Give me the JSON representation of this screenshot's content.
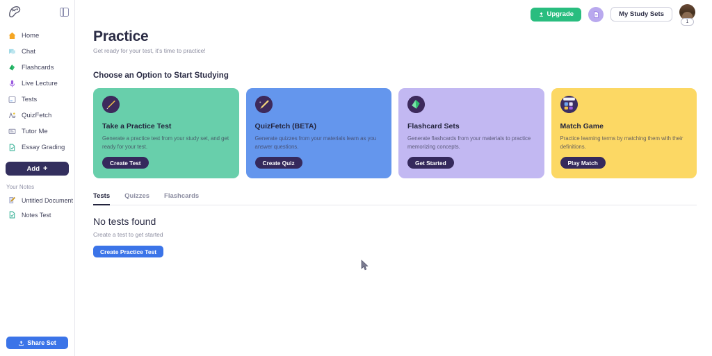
{
  "sidebar": {
    "logo_name": "app-logo",
    "toggle_name": "panel-toggle-icon",
    "nav": [
      {
        "label": "Home",
        "icon": "home-icon"
      },
      {
        "label": "Chat",
        "icon": "chat-icon"
      },
      {
        "label": "Flashcards",
        "icon": "flashcards-icon"
      },
      {
        "label": "Live Lecture",
        "icon": "microphone-icon"
      },
      {
        "label": "Tests",
        "icon": "tests-icon"
      },
      {
        "label": "QuizFetch",
        "icon": "quizfetch-icon"
      },
      {
        "label": "Tutor Me",
        "icon": "tutor-icon"
      },
      {
        "label": "Essay Grading",
        "icon": "essay-grading-icon"
      }
    ],
    "add_label": "Add",
    "add_plus": "+",
    "notes_heading": "Your Notes",
    "notes": [
      {
        "label": "Untitled Document",
        "icon": "note-pencil-icon"
      },
      {
        "label": "Notes Test",
        "icon": "note-check-icon"
      }
    ],
    "share_label": "Share Set"
  },
  "topbar": {
    "upgrade_label": "Upgrade",
    "doc_icon": "document-icon",
    "study_sets_label": "My Study Sets",
    "avatar_badge": "1"
  },
  "header": {
    "title": "Practice",
    "subtitle": "Get ready for your test, it's time to practice!"
  },
  "main": {
    "section_title": "Choose an Option to Start Studying",
    "cards": [
      {
        "title": "Take a Practice Test",
        "description": "Generate a practice test from your study set, and get ready for your test.",
        "button": "Create Test",
        "icon": "pencil-badge-icon",
        "bg": "#68cfab"
      },
      {
        "title": "QuizFetch (BETA)",
        "description": "Generate quizzes from your materials learn as you answer questions.",
        "button": "Create Quiz",
        "icon": "quiz-badge-icon",
        "bg": "#6496ed"
      },
      {
        "title": "Flashcard Sets",
        "description": "Generate flashcards from your materials to practice memorizing concepts.",
        "button": "Get Started",
        "icon": "cards-badge-icon",
        "bg": "#c2b8f2"
      },
      {
        "title": "Match Game",
        "description": "Practice learning terms by matching them with their definitions.",
        "button": "Play Match",
        "icon": "match-badge-icon",
        "bg": "#fcd864"
      }
    ],
    "tabs": [
      {
        "label": "Tests",
        "active": true
      },
      {
        "label": "Quizzes",
        "active": false
      },
      {
        "label": "Flashcards",
        "active": false
      }
    ],
    "empty_title": "No tests found",
    "empty_subtitle": "Create a test to get started",
    "empty_button": "Create Practice Test"
  },
  "colors": {
    "accent_blue": "#3b74e8",
    "upgrade_green": "#29bd7f",
    "dark_purple": "#332f5e",
    "text_dark": "#2b2c45",
    "text_muted": "#8b8c9f"
  }
}
